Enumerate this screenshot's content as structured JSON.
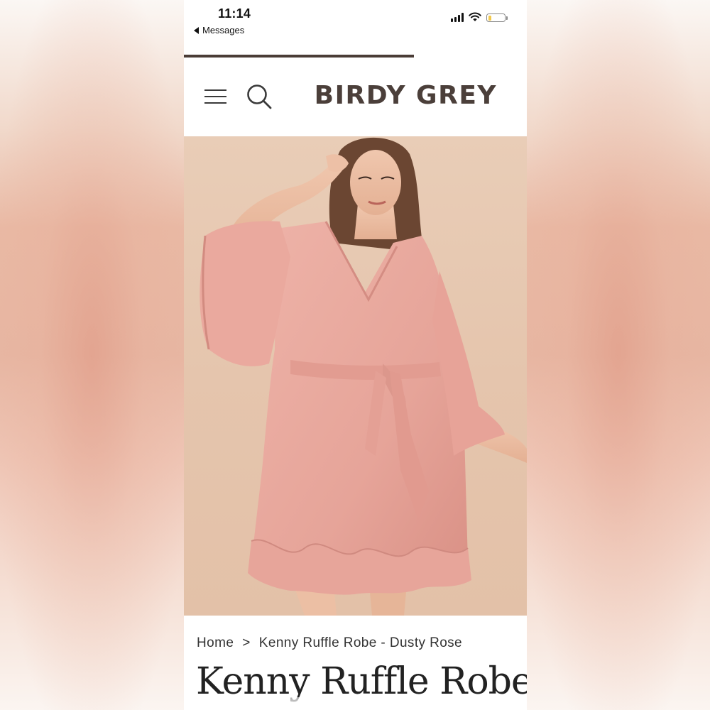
{
  "status_bar": {
    "time": "11:14",
    "back_label": "Messages",
    "battery_level": 0.2
  },
  "page_progress": 0.67,
  "header": {
    "brand": "BIRDY GREY"
  },
  "hero": {
    "alt": "Kenny Ruffle Robe - Dusty Rose product photo",
    "colors": {
      "background": "#e7c7b0",
      "garment": "#e8a99f"
    }
  },
  "breadcrumb": {
    "home": "Home",
    "separator": ">",
    "current": "Kenny Ruffle Robe - Dusty Rose"
  },
  "product": {
    "title": "Kenny Ruffle Robe"
  }
}
